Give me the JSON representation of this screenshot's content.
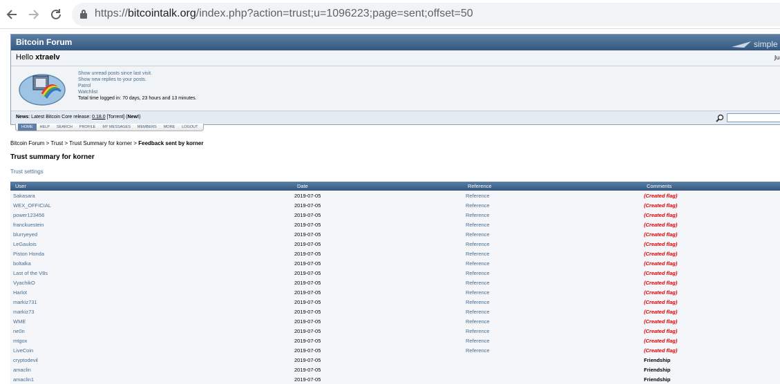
{
  "browser": {
    "url_protocol": "https://",
    "url_host": "bitcointalk.org",
    "url_path": "/index.php?action=trust;u=1096223;page=sent;offset=50"
  },
  "header": {
    "forum_title": "Bitcoin Forum",
    "logo_text": "simple",
    "hello_prefix": "Hello ",
    "username": "xtraelv",
    "date_fragment": "Ju",
    "links": [
      "Show unread posts since last visit.",
      "Show new replies to your posts.",
      "Patrol",
      "Watchlist"
    ],
    "time_logged": "Total time logged in: 70 days, 23 hours and 13 minutes.",
    "news_label": "News",
    "news_text": ": Latest Bitcoin Core release: ",
    "news_version": "0.18.0",
    "news_torrent": "[Torrent]",
    "news_new": "(New!)"
  },
  "menu": [
    "HOME",
    "HELP",
    "SEARCH",
    "PROFILE",
    "MY MESSAGES",
    "MEMBERS",
    "MORE",
    "LOGOUT"
  ],
  "breadcrumb": {
    "items": [
      "Bitcoin Forum",
      "Trust",
      "Trust Summary for korner"
    ],
    "separator": " > ",
    "current": "Feedback sent by korner"
  },
  "page_title": "Trust summary for korner",
  "trust_settings": "Trust settings",
  "table": {
    "headers": [
      "User",
      "Date",
      "Reference",
      "Comments"
    ],
    "rows": [
      {
        "user": "Sakasara",
        "date": "2019-07-05",
        "reference": "Reference",
        "comment": "(Created flag)"
      },
      {
        "user": "WEX_OFFICIAL",
        "date": "2019-07-05",
        "reference": "Reference",
        "comment": "(Created flag)"
      },
      {
        "user": "power123456",
        "date": "2019-07-05",
        "reference": "Reference",
        "comment": "(Created flag)"
      },
      {
        "user": "franckuestein",
        "date": "2019-07-05",
        "reference": "Reference",
        "comment": "(Created flag)"
      },
      {
        "user": "blurryeyed",
        "date": "2019-07-05",
        "reference": "Reference",
        "comment": "(Created flag)"
      },
      {
        "user": "LeGaulois",
        "date": "2019-07-05",
        "reference": "Reference",
        "comment": "(Created flag)"
      },
      {
        "user": "Piston Honda",
        "date": "2019-07-05",
        "reference": "Reference",
        "comment": "(Created flag)"
      },
      {
        "user": "boltalka",
        "date": "2019-07-05",
        "reference": "Reference",
        "comment": "(Created flag)"
      },
      {
        "user": "Last of the V8s",
        "date": "2019-07-05",
        "reference": "Reference",
        "comment": "(Created flag)"
      },
      {
        "user": "VyachikO",
        "date": "2019-07-05",
        "reference": "Reference",
        "comment": "(Created flag)"
      },
      {
        "user": "Harlot",
        "date": "2019-07-05",
        "reference": "Reference",
        "comment": "(Created flag)"
      },
      {
        "user": "markiz731",
        "date": "2019-07-05",
        "reference": "Reference",
        "comment": "(Created flag)"
      },
      {
        "user": "markiz73",
        "date": "2019-07-05",
        "reference": "Reference",
        "comment": "(Created flag)"
      },
      {
        "user": "WME",
        "date": "2019-07-05",
        "reference": "Reference",
        "comment": "(Created flag)"
      },
      {
        "user": "ne0n",
        "date": "2019-07-05",
        "reference": "Reference",
        "comment": "(Created flag)"
      },
      {
        "user": "mtgox",
        "date": "2019-07-05",
        "reference": "Reference",
        "comment": "(Created flag)"
      },
      {
        "user": "LiveCoin",
        "date": "2019-07-05",
        "reference": "Reference",
        "comment": "(Created flag)"
      },
      {
        "user": "cryptodevil",
        "date": "2019-07-05",
        "reference": "",
        "comment": "Friendship"
      },
      {
        "user": "amaclin",
        "date": "2019-07-05",
        "reference": "",
        "comment": "Friendship"
      },
      {
        "user": "amaclin1",
        "date": "2019-07-05",
        "reference": "",
        "comment": "Friendship"
      }
    ]
  },
  "colors": {
    "link": "#476c8e",
    "flag": "#e00000",
    "header_bg": "#34587f"
  },
  "icons": [
    "back-arrow-icon",
    "forward-arrow-icon",
    "reload-icon",
    "lock-icon",
    "search-icon"
  ]
}
